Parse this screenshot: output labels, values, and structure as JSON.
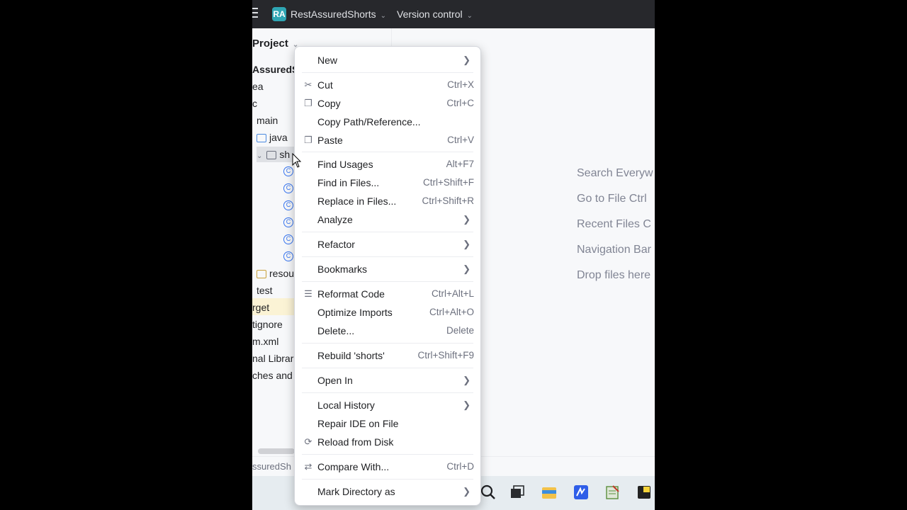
{
  "titlebar": {
    "badge": "RA",
    "project": "RestAssuredShorts",
    "version_control": "Version control"
  },
  "project_pane": {
    "header": "Project",
    "rows": [
      "AssuredS",
      "ea",
      "c",
      "main",
      "java",
      "sh",
      "resou",
      "test",
      "rget",
      "tignore",
      "m.xml",
      "nal Librari",
      "ches and"
    ]
  },
  "class_icon_glyph": "C",
  "statusbar": {
    "breadcrumb": "ssuredSh"
  },
  "editor_hints": [
    "Search Everyw",
    "Go to File Ctrl",
    "Recent Files C",
    "Navigation Bar",
    "Drop files here"
  ],
  "menu": {
    "new": {
      "label": "New"
    },
    "cut": {
      "label": "Cut",
      "shortcut": "Ctrl+X",
      "icon": "scissors-icon"
    },
    "copy": {
      "label": "Copy",
      "shortcut": "Ctrl+C",
      "icon": "copy-icon"
    },
    "copy_path": {
      "label": "Copy Path/Reference..."
    },
    "paste": {
      "label": "Paste",
      "shortcut": "Ctrl+V",
      "icon": "paste-icon"
    },
    "find_usages": {
      "label": "Find Usages",
      "shortcut": "Alt+F7"
    },
    "find_in_files": {
      "label": "Find in Files...",
      "shortcut": "Ctrl+Shift+F"
    },
    "replace_in_files": {
      "label": "Replace in Files...",
      "shortcut": "Ctrl+Shift+R"
    },
    "analyze": {
      "label": "Analyze"
    },
    "refactor": {
      "label": "Refactor"
    },
    "bookmarks": {
      "label": "Bookmarks"
    },
    "reformat": {
      "label": "Reformat Code",
      "shortcut": "Ctrl+Alt+L",
      "icon": "reformat-icon"
    },
    "optimize": {
      "label": "Optimize Imports",
      "shortcut": "Ctrl+Alt+O"
    },
    "delete": {
      "label": "Delete...",
      "shortcut": "Delete"
    },
    "rebuild": {
      "label": "Rebuild 'shorts'",
      "shortcut": "Ctrl+Shift+F9"
    },
    "open_in": {
      "label": "Open In"
    },
    "local_history": {
      "label": "Local History"
    },
    "repair": {
      "label": "Repair IDE on File"
    },
    "reload": {
      "label": "Reload from Disk",
      "icon": "reload-icon"
    },
    "compare": {
      "label": "Compare With...",
      "shortcut": "Ctrl+D",
      "icon": "compare-icon"
    },
    "mark_dir": {
      "label": "Mark Directory as"
    }
  },
  "colors": {
    "accent": "#3574f0",
    "titlebar_bg": "#27282c",
    "menu_bg": "#ffffff",
    "selection": "#fbf3d5"
  }
}
